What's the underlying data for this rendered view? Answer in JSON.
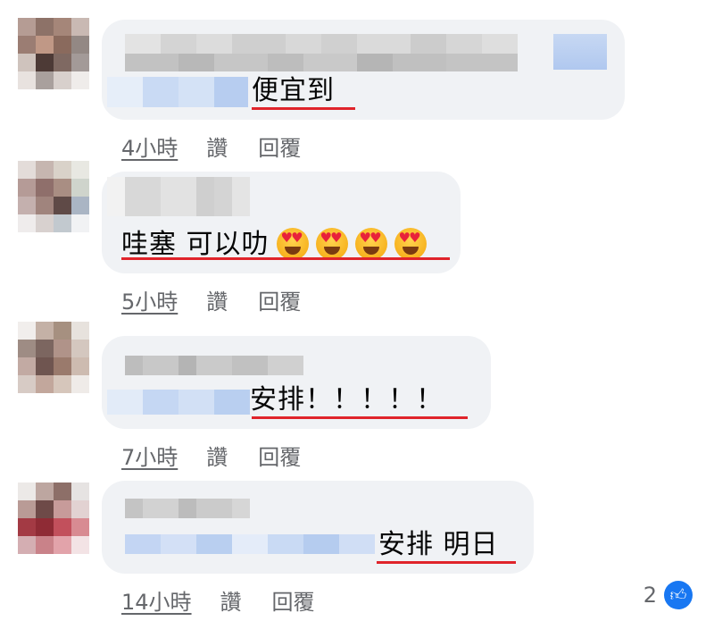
{
  "comments": [
    {
      "text": "便宜到",
      "time": "4小時",
      "like_label": "讚",
      "reply_label": "回覆"
    },
    {
      "text": "哇塞 可以叻",
      "emoji_name": "heart-eyes-emoji",
      "emoji_count": 4,
      "time": "5小時",
      "like_label": "讚",
      "reply_label": "回覆"
    },
    {
      "text": "安排！！！！！",
      "time": "7小時",
      "like_label": "讚",
      "reply_label": "回覆"
    },
    {
      "text": "安排 明日",
      "time": "14小時",
      "like_label": "讚",
      "reply_label": "回覆"
    }
  ],
  "reaction": {
    "count": "2",
    "icon": "like-icon"
  },
  "colors": {
    "bubble": "#f0f2f5",
    "underline": "#e0242b",
    "meta_text": "#65676b",
    "like_blue": "#1877f2"
  }
}
